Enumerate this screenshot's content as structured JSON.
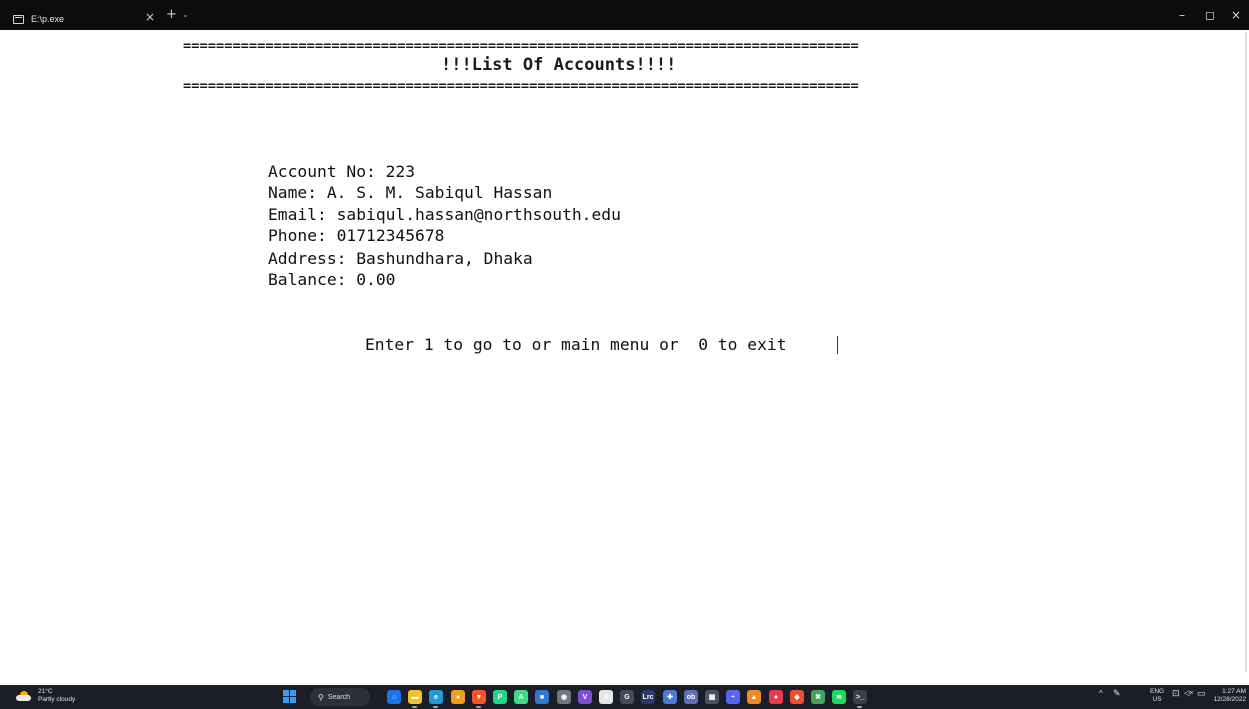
{
  "window": {
    "tab_title": "E:\\p.exe",
    "tab_close": "×",
    "new_tab": "+",
    "tab_dropdown": "⌄",
    "minimize": "–",
    "maximize": "◻",
    "close": "×"
  },
  "console": {
    "separator_top": "==================================================================================",
    "heading": "!!!List Of Accounts!!!!",
    "separator_bottom": "==================================================================================",
    "account": {
      "account_no": "Account No: 223",
      "name": "Name: A. S. M. Sabiqul Hassan",
      "email": "Email: sabiqul.hassan@northsouth.edu",
      "phone": "Phone: 01712345678",
      "address": "Address: Bashundhara, Dhaka",
      "balance": "Balance: 0.00"
    },
    "prompt": "Enter 1 to go to or main menu or  0 to exit "
  },
  "taskbar": {
    "weather_temp": "21°C",
    "weather_desc": "Partly cloudy",
    "search_label": "Search",
    "apps": [
      {
        "name": "cortana-icon",
        "color": "#1a73e8",
        "glyph": "○"
      },
      {
        "name": "file-explorer-icon",
        "color": "#f2c12e",
        "glyph": "▬"
      },
      {
        "name": "edge-icon",
        "color": "#1f9bd7",
        "glyph": "e"
      },
      {
        "name": "chrome-icon",
        "color": "#f29b1d",
        "glyph": "●"
      },
      {
        "name": "brave-icon",
        "color": "#fb542b",
        "glyph": "▼"
      },
      {
        "name": "pycharm-icon",
        "color": "#21d789",
        "glyph": "P"
      },
      {
        "name": "android-studio-icon",
        "color": "#3ddc84",
        "glyph": "A"
      },
      {
        "name": "calendar-app-icon",
        "color": "#2f78d6",
        "glyph": "■"
      },
      {
        "name": "github-icon",
        "color": "#6e7681",
        "glyph": "◉"
      },
      {
        "name": "visual-studio-icon",
        "color": "#7e4dd2",
        "glyph": "V"
      },
      {
        "name": "xbox-icon",
        "color": "#e6e6e6",
        "glyph": "X"
      },
      {
        "name": "codeblocks-icon",
        "color": "#444a5a",
        "glyph": "G"
      },
      {
        "name": "lightroom-icon",
        "color": "#2b3a67",
        "glyph": "Lrc"
      },
      {
        "name": "app-icon-blue",
        "color": "#4a7bdc",
        "glyph": "✚"
      },
      {
        "name": "ob-icon",
        "color": "#5a6fb6",
        "glyph": "ob"
      },
      {
        "name": "calculator-icon",
        "color": "#4b5263",
        "glyph": "▦"
      },
      {
        "name": "discord-icon",
        "color": "#5865f2",
        "glyph": "◓"
      },
      {
        "name": "vlc-icon",
        "color": "#f08a24",
        "glyph": "▲"
      },
      {
        "name": "app-icon-red",
        "color": "#e23d4b",
        "glyph": "●"
      },
      {
        "name": "git-icon",
        "color": "#f05032",
        "glyph": "◆"
      },
      {
        "name": "app-icon-green",
        "color": "#46a35e",
        "glyph": "✖"
      },
      {
        "name": "spotify-icon",
        "color": "#1ed760",
        "glyph": "≋"
      },
      {
        "name": "terminal-icon",
        "color": "#3a3f4b",
        "glyph": ">_"
      }
    ],
    "tray_chevron": "^",
    "tray_pen": "✎",
    "lang_top": "ENG",
    "lang_bottom": "US",
    "tray_display": "⊡",
    "tray_volume": "◁×",
    "tray_battery": "▭",
    "time": "1:27 AM",
    "date": "12/28/2022"
  }
}
